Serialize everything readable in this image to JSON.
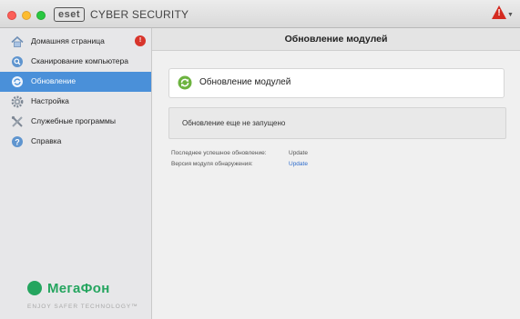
{
  "app": {
    "logo_text": "eset",
    "product_name": "CYBER SECURITY"
  },
  "sidebar": {
    "items": [
      {
        "label": "Домашняя страница",
        "icon": "home-icon",
        "badge": "!"
      },
      {
        "label": "Сканирование компьютера",
        "icon": "scan-icon"
      },
      {
        "label": "Обновление",
        "icon": "update-icon",
        "active": true
      },
      {
        "label": "Настройка",
        "icon": "gear-icon"
      },
      {
        "label": "Служебные программы",
        "icon": "tools-icon"
      },
      {
        "label": "Справка",
        "icon": "help-icon"
      }
    ],
    "partner_logo": "МегаФон",
    "tagline": "ENJOY SAFER TECHNOLOGY™"
  },
  "main": {
    "title": "Обновление модулей",
    "module_card": {
      "title": "Обновление модулей",
      "icon": "refresh-icon"
    },
    "status": "Обновление еще не запущено",
    "info": [
      {
        "label": "Последнее успешное обновление:",
        "value": "Update"
      },
      {
        "label": "Версия модуля обнаружения:",
        "value": "Update"
      }
    ]
  },
  "colors": {
    "accent": "#4a90d9",
    "alert": "#d42a20",
    "partner": "#25a55f",
    "link": "#2d6ccc"
  }
}
